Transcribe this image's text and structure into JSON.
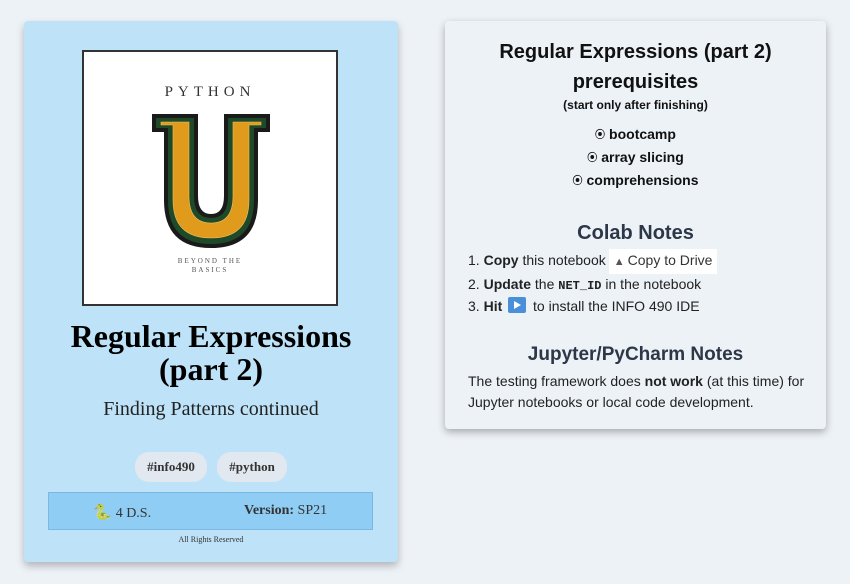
{
  "left_card": {
    "cover": {
      "top_text": "PYTHON",
      "letter": "U",
      "bottom_line1": "BEYOND THE",
      "bottom_line2": "BASICS"
    },
    "title_line1": "Regular Expressions",
    "title_line2": "(part 2)",
    "subtitle": "Finding Patterns continued",
    "tags": [
      "#info490",
      "#python"
    ],
    "footer": {
      "author": "4 D.S.",
      "version_label": "Version:",
      "version_value": "SP21"
    },
    "rights": "All Rights Reserved"
  },
  "right_card": {
    "heading": "Regular Expressions (part 2)",
    "prereq_heading": "prerequisites",
    "prereq_note": "(start only after finishing)",
    "prereqs": [
      "bootcamp",
      "array slicing",
      "comprehensions"
    ],
    "colab_heading": "Colab Notes",
    "steps": {
      "s1_bold": "Copy",
      "s1_text": "this notebook",
      "drive_button": "Copy to Drive",
      "s2_bold": "Update",
      "s2_pre": "the",
      "s2_code": "NET_ID",
      "s2_post": "in the notebook",
      "s3_bold": "Hit",
      "s3_text": "to install the INFO 490 IDE"
    },
    "jupyter_heading": "Jupyter/PyCharm Notes",
    "jupyter_pre": "The testing framework does",
    "jupyter_bold": "not work",
    "jupyter_post": "(at this time) for Jupyter notebooks or local code development."
  },
  "colors": {
    "left_card_bg": "#bee3f8",
    "footer_bg": "#90cdf4",
    "page_bg": "#edf2f7",
    "cover_u_fill": "#e09a1c",
    "cover_u_outline": "#1e4a2a"
  },
  "icons": [
    "snake-icon",
    "google-drive-icon",
    "play-icon",
    "radio-bullet-icon"
  ]
}
